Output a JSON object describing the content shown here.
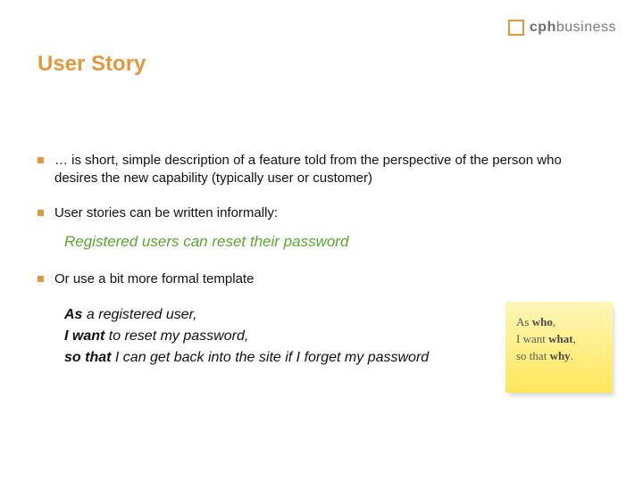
{
  "brand": {
    "cph": "cph",
    "rest": "business"
  },
  "title": "User Story",
  "bullets": {
    "b1": "… is short, simple description of a feature told from the perspective of the person who desires the new capability (typically user or customer)",
    "b2": "User stories can be written informally:",
    "b3": "Or use a bit more formal template"
  },
  "example": "Registered users can reset their password",
  "formal": {
    "l1": {
      "kw": "As",
      "rest": " a registered user,"
    },
    "l2": {
      "kw": "I want",
      "rest": " to reset my password,"
    },
    "l3": {
      "kw": "so that",
      "rest": " I can get back into the site if I forget my password"
    }
  },
  "sticky": {
    "l1a": "As ",
    "l1b": "who",
    "l1c": ",",
    "l2a": "I want ",
    "l2b": "what",
    "l2c": ",",
    "l3a": "so that ",
    "l3b": "why",
    "l3c": "."
  }
}
